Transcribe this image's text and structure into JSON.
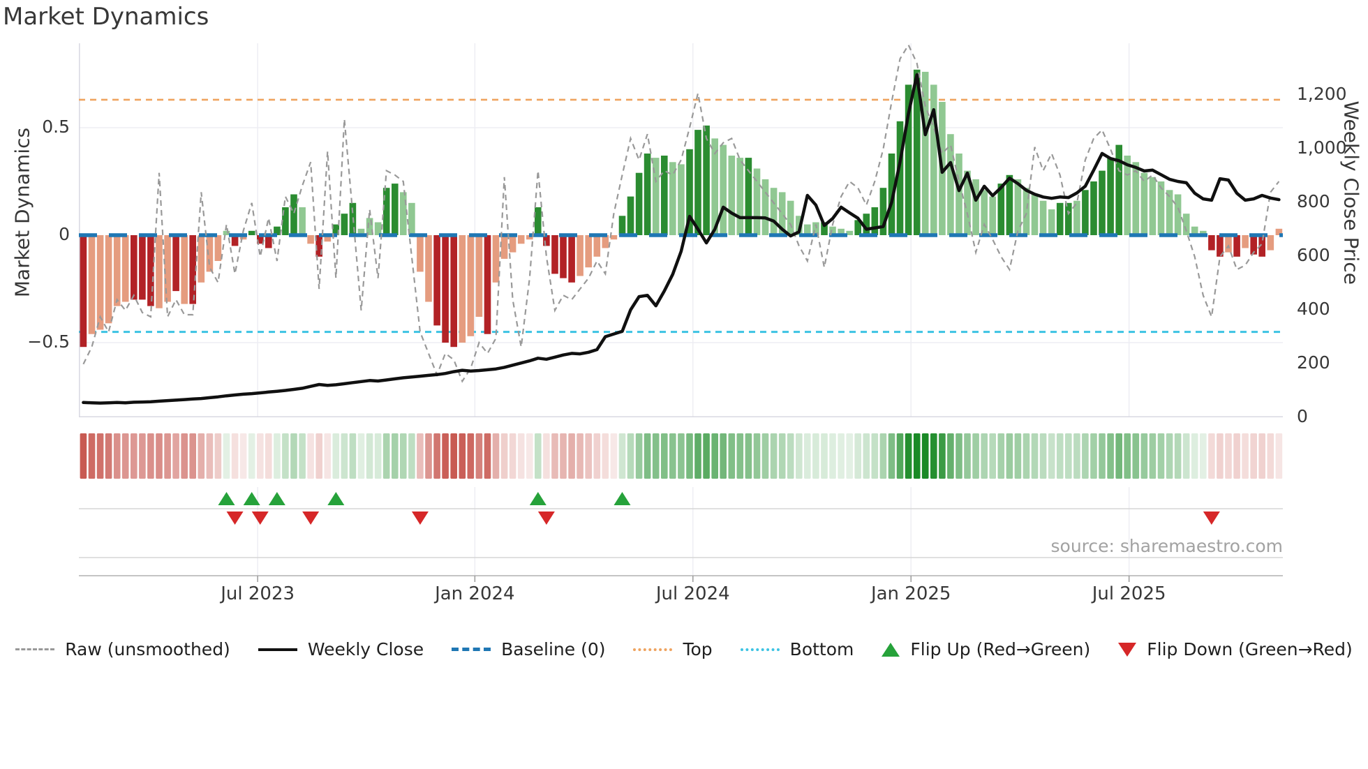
{
  "title": "Market Dynamics",
  "source_text": "source: sharemaestro.com",
  "axes": {
    "left_title": "Market Dynamics",
    "right_title": "Weekly Close Price",
    "left_tick_labels": [
      "0.5",
      "0",
      "−0.5"
    ],
    "left_tick_values": [
      0.5,
      0,
      -0.5
    ],
    "right_tick_labels": [
      "1,200",
      "1,000",
      "800",
      "600",
      "400",
      "200",
      "0"
    ],
    "right_tick_values": [
      1200,
      1000,
      800,
      600,
      400,
      200,
      0
    ],
    "x_tick_labels": [
      "Jul 2023",
      "Jan 2024",
      "Jul 2024",
      "Jan 2025",
      "Jul 2025"
    ],
    "x_tick_week_index": [
      20.7,
      46.5,
      72.4,
      98.3,
      124.2
    ]
  },
  "legend": [
    {
      "label": "Raw (unsmoothed)",
      "swatch": "dashed-line",
      "color": "#999999"
    },
    {
      "label": "Weekly Close",
      "swatch": "solid-line",
      "color": "#111111"
    },
    {
      "label": "Baseline (0)",
      "swatch": "dashed-thick",
      "color": "#1f77b4"
    },
    {
      "label": "Top",
      "swatch": "dotted-line",
      "color": "#efa35f"
    },
    {
      "label": "Bottom",
      "swatch": "dotted-line",
      "color": "#3cc3e3"
    },
    {
      "label": "Flip Up (Red→Green)",
      "swatch": "triangle-up",
      "color": "#26a23a"
    },
    {
      "label": "Flip Down (Green→Red)",
      "swatch": "triangle-down",
      "color": "#d62728"
    }
  ],
  "colors": {
    "bar_green_strong": "#2b8c31",
    "bar_green_light": "#90c892",
    "bar_red_strong": "#b22226",
    "bar_red_light": "#e59c7f",
    "baseline": "#1f77b4",
    "top_line": "#efa35f",
    "bottom_line": "#3cc3e3",
    "raw_line": "#999999",
    "price_line": "#101010",
    "grid": "#ededf3",
    "spine": "#d8d8e2",
    "marker_up": "#26a23a",
    "marker_down": "#d62728"
  },
  "chart_data": {
    "type": "bar",
    "subtype": "weekly oscillator bars + raw dashed line (left axis) + weekly close price line (right axis) + heatmap strip + flip markers",
    "weeks": 143,
    "baseline": 0,
    "top_line": 0.63,
    "bottom_line": -0.45,
    "left_ylim": [
      -0.87,
      0.89
    ],
    "right_ylim": [
      0,
      1392
    ],
    "x_range_note": "weekly data, Feb 2023 to Nov 2025",
    "smoothed": [
      -0.52,
      -0.46,
      -0.44,
      -0.41,
      -0.33,
      -0.31,
      -0.3,
      -0.3,
      -0.33,
      -0.34,
      -0.31,
      -0.26,
      -0.32,
      -0.32,
      -0.22,
      -0.17,
      -0.12,
      0.02,
      -0.05,
      -0.02,
      0.02,
      -0.04,
      -0.06,
      0.04,
      0.13,
      0.19,
      0.13,
      -0.04,
      -0.1,
      -0.03,
      0.05,
      0.1,
      0.15,
      0.03,
      0.08,
      0.06,
      0.22,
      0.24,
      0.2,
      0.15,
      -0.17,
      -0.31,
      -0.42,
      -0.5,
      -0.52,
      -0.5,
      -0.47,
      -0.38,
      -0.46,
      -0.22,
      -0.11,
      -0.08,
      -0.04,
      -0.02,
      0.13,
      -0.05,
      -0.18,
      -0.2,
      -0.22,
      -0.19,
      -0.15,
      -0.1,
      -0.06,
      -0.02,
      0.09,
      0.18,
      0.29,
      0.38,
      0.36,
      0.37,
      0.34,
      0.33,
      0.4,
      0.49,
      0.51,
      0.45,
      0.42,
      0.37,
      0.36,
      0.36,
      0.31,
      0.26,
      0.22,
      0.2,
      0.16,
      0.09,
      0.05,
      0.06,
      0.06,
      0.04,
      0.03,
      0.02,
      0.07,
      0.1,
      0.13,
      0.22,
      0.38,
      0.53,
      0.7,
      0.77,
      0.76,
      0.7,
      0.62,
      0.47,
      0.38,
      0.3,
      0.26,
      0.21,
      0.18,
      0.24,
      0.28,
      0.26,
      0.22,
      0.19,
      0.16,
      0.12,
      0.15,
      0.15,
      0.16,
      0.21,
      0.25,
      0.3,
      0.36,
      0.42,
      0.37,
      0.34,
      0.29,
      0.27,
      0.25,
      0.21,
      0.19,
      0.1,
      0.04,
      0.02,
      -0.07,
      -0.1,
      -0.08,
      -0.1,
      -0.06,
      -0.09,
      -0.1,
      -0.07,
      0.03
    ],
    "shade": "DLLLLLDDDLLDLDLLLLDLDDDDDDLLDLDDDLLLDDLLLLDDDLLLDLLLLLDDDDDLLLLLDDDDLDLLDDDLLLLDLLLLLLLLDLLLDDDDDDDDLLLLLLLLLDDLLLLLDDLDDDDDLLLLLLLLLLDDLDLDDLS",
    "raw": [
      -0.6,
      -0.52,
      -0.38,
      -0.45,
      -0.3,
      -0.35,
      -0.28,
      -0.36,
      -0.38,
      0.29,
      -0.38,
      -0.3,
      -0.37,
      -0.37,
      0.2,
      -0.15,
      -0.22,
      0.05,
      -0.18,
      0.02,
      0.15,
      -0.1,
      0.08,
      -0.12,
      0.18,
      0.1,
      0.23,
      0.34,
      -0.25,
      0.39,
      -0.2,
      0.54,
      0.1,
      -0.35,
      0.12,
      -0.2,
      0.3,
      0.28,
      0.25,
      -0.1,
      -0.45,
      -0.55,
      -0.65,
      -0.55,
      -0.58,
      -0.68,
      -0.62,
      -0.5,
      -0.55,
      -0.48,
      0.27,
      -0.3,
      -0.52,
      -0.2,
      0.3,
      -0.1,
      -0.35,
      -0.28,
      -0.3,
      -0.25,
      -0.2,
      -0.12,
      -0.18,
      0.1,
      0.28,
      0.45,
      0.35,
      0.47,
      0.25,
      0.3,
      0.28,
      0.35,
      0.5,
      0.66,
      0.45,
      0.38,
      0.43,
      0.45,
      0.35,
      0.3,
      0.25,
      0.2,
      0.15,
      0.1,
      0.05,
      -0.05,
      -0.12,
      0.05,
      -0.15,
      0.05,
      0.18,
      0.25,
      0.22,
      0.14,
      0.25,
      0.4,
      0.62,
      0.82,
      0.885,
      0.8,
      0.6,
      0.5,
      0.38,
      0.42,
      0.25,
      0.1,
      -0.08,
      0.05,
      -0.02,
      -0.1,
      -0.16,
      0.02,
      0.1,
      0.41,
      0.3,
      0.38,
      0.28,
      0.1,
      0.15,
      0.35,
      0.45,
      0.49,
      0.4,
      0.3,
      0.28,
      0.3,
      0.25,
      0.28,
      0.22,
      0.18,
      0.13,
      0.02,
      -0.1,
      -0.28,
      -0.38,
      -0.1,
      -0.05,
      -0.16,
      -0.14,
      -0.08,
      -0.04,
      0.2,
      0.25
    ],
    "price": [
      55,
      54,
      53,
      54,
      55,
      54,
      56,
      57,
      58,
      60,
      62,
      64,
      66,
      68,
      70,
      73,
      76,
      80,
      83,
      86,
      88,
      91,
      94,
      97,
      100,
      104,
      108,
      115,
      122,
      119,
      121,
      125,
      129,
      133,
      137,
      135,
      139,
      143,
      147,
      150,
      153,
      156,
      159,
      163,
      170,
      175,
      172,
      174,
      177,
      180,
      186,
      194,
      202,
      210,
      220,
      216,
      224,
      232,
      238,
      236,
      242,
      252,
      300,
      310,
      320,
      400,
      449,
      454,
      415,
      470,
      532,
      618,
      748,
      700,
      649,
      700,
      782,
      760,
      743,
      743,
      743,
      742,
      730,
      700,
      675,
      690,
      826,
      790,
      714,
      740,
      782,
      761,
      741,
      700,
      705,
      710,
      800,
      950,
      1130,
      1275,
      1052,
      1145,
      912,
      948,
      844,
      909,
      808,
      860,
      825,
      855,
      890,
      870,
      845,
      830,
      820,
      815,
      820,
      818,
      835,
      860,
      920,
      982,
      963,
      955,
      940,
      930,
      917,
      920,
      903,
      886,
      878,
      873,
      834,
      813,
      808,
      888,
      883,
      834,
      808,
      813,
      826,
      816,
      810
    ],
    "flip_up_weeks": [
      17,
      20,
      23,
      30,
      54,
      64
    ],
    "flip_down_weeks": [
      18,
      21,
      27,
      40,
      55,
      134
    ]
  }
}
